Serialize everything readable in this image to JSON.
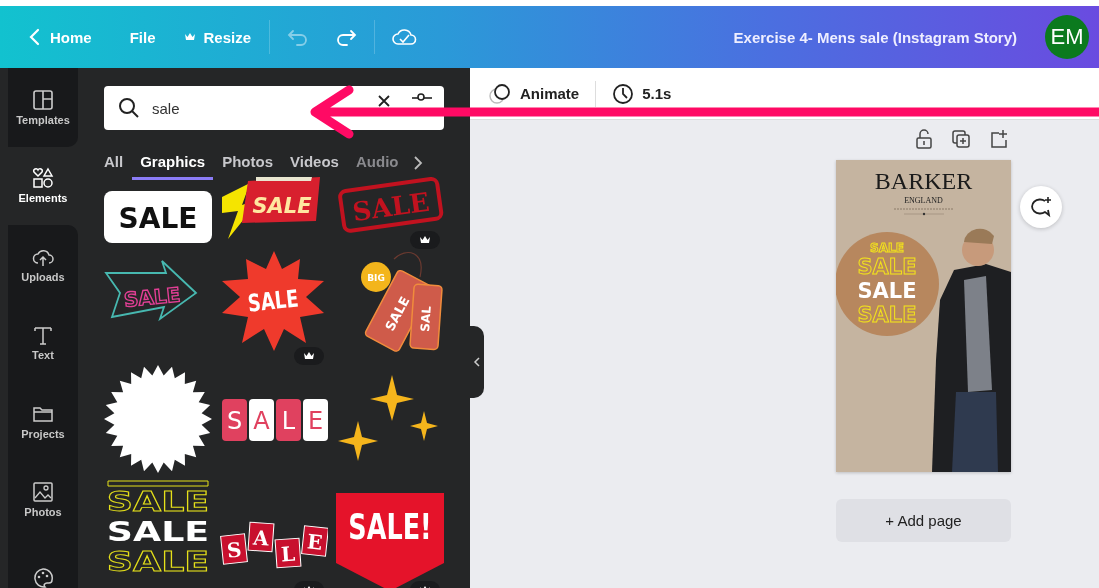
{
  "topbar": {
    "back": "Home",
    "menu": [
      {
        "label": "File",
        "premium": false
      },
      {
        "label": "Resize",
        "premium": true
      }
    ],
    "undo_disabled": true,
    "redo_disabled": false,
    "title": "Exercise 4- Mens sale (Instagram Story)",
    "avatar": "EM"
  },
  "rail": [
    {
      "label": "Templates",
      "selected": false
    },
    {
      "label": "Elements",
      "selected": true
    },
    {
      "label": "Uploads",
      "selected": false
    },
    {
      "label": "Text",
      "selected": false
    },
    {
      "label": "Projects",
      "selected": false
    },
    {
      "label": "Photos",
      "selected": false
    },
    {
      "selected": false
    }
  ],
  "search": {
    "value": "sale"
  },
  "tabs": [
    {
      "label": "All",
      "selected": false
    },
    {
      "label": "Graphics",
      "selected": true
    },
    {
      "label": "Photos",
      "selected": false
    },
    {
      "label": "Videos",
      "selected": false
    },
    {
      "label": "Audio",
      "selected": false
    }
  ],
  "graphics": [
    {
      "kind": "pill",
      "texts": [
        "SALE"
      ],
      "premium": false
    },
    {
      "kind": "flash",
      "texts": [
        "SALE"
      ],
      "premium": false
    },
    {
      "kind": "stamp",
      "texts": [
        "SALE"
      ],
      "premium": true
    },
    {
      "kind": "arrow",
      "texts": [
        "SALE"
      ],
      "premium": false
    },
    {
      "kind": "burst",
      "texts": [
        "SALE"
      ],
      "premium": true
    },
    {
      "kind": "tags",
      "texts": [
        "BIG",
        "SALE",
        "SAL"
      ],
      "premium": false
    },
    {
      "kind": "seal",
      "premium": false
    },
    {
      "kind": "letters",
      "texts": [
        "S",
        "A",
        "L",
        "E"
      ],
      "premium": false
    },
    {
      "kind": "sparkles",
      "premium": false
    },
    {
      "kind": "stack",
      "texts": [
        "SALE",
        "SALE",
        "SALE"
      ],
      "premium": false
    },
    {
      "kind": "hanging",
      "texts": [
        "S",
        "A",
        "L",
        "E"
      ],
      "premium": true
    },
    {
      "kind": "banner",
      "texts": [
        "SALE!"
      ],
      "premium": true
    }
  ],
  "toolbar": {
    "animate": "Animate",
    "duration": "5.1s"
  },
  "design": {
    "brand": "BARKER",
    "origin": "ENGLAND",
    "circle_texts": [
      "SALE",
      "SALE",
      "SALE",
      "SALE"
    ]
  },
  "add_page": "+ Add page"
}
